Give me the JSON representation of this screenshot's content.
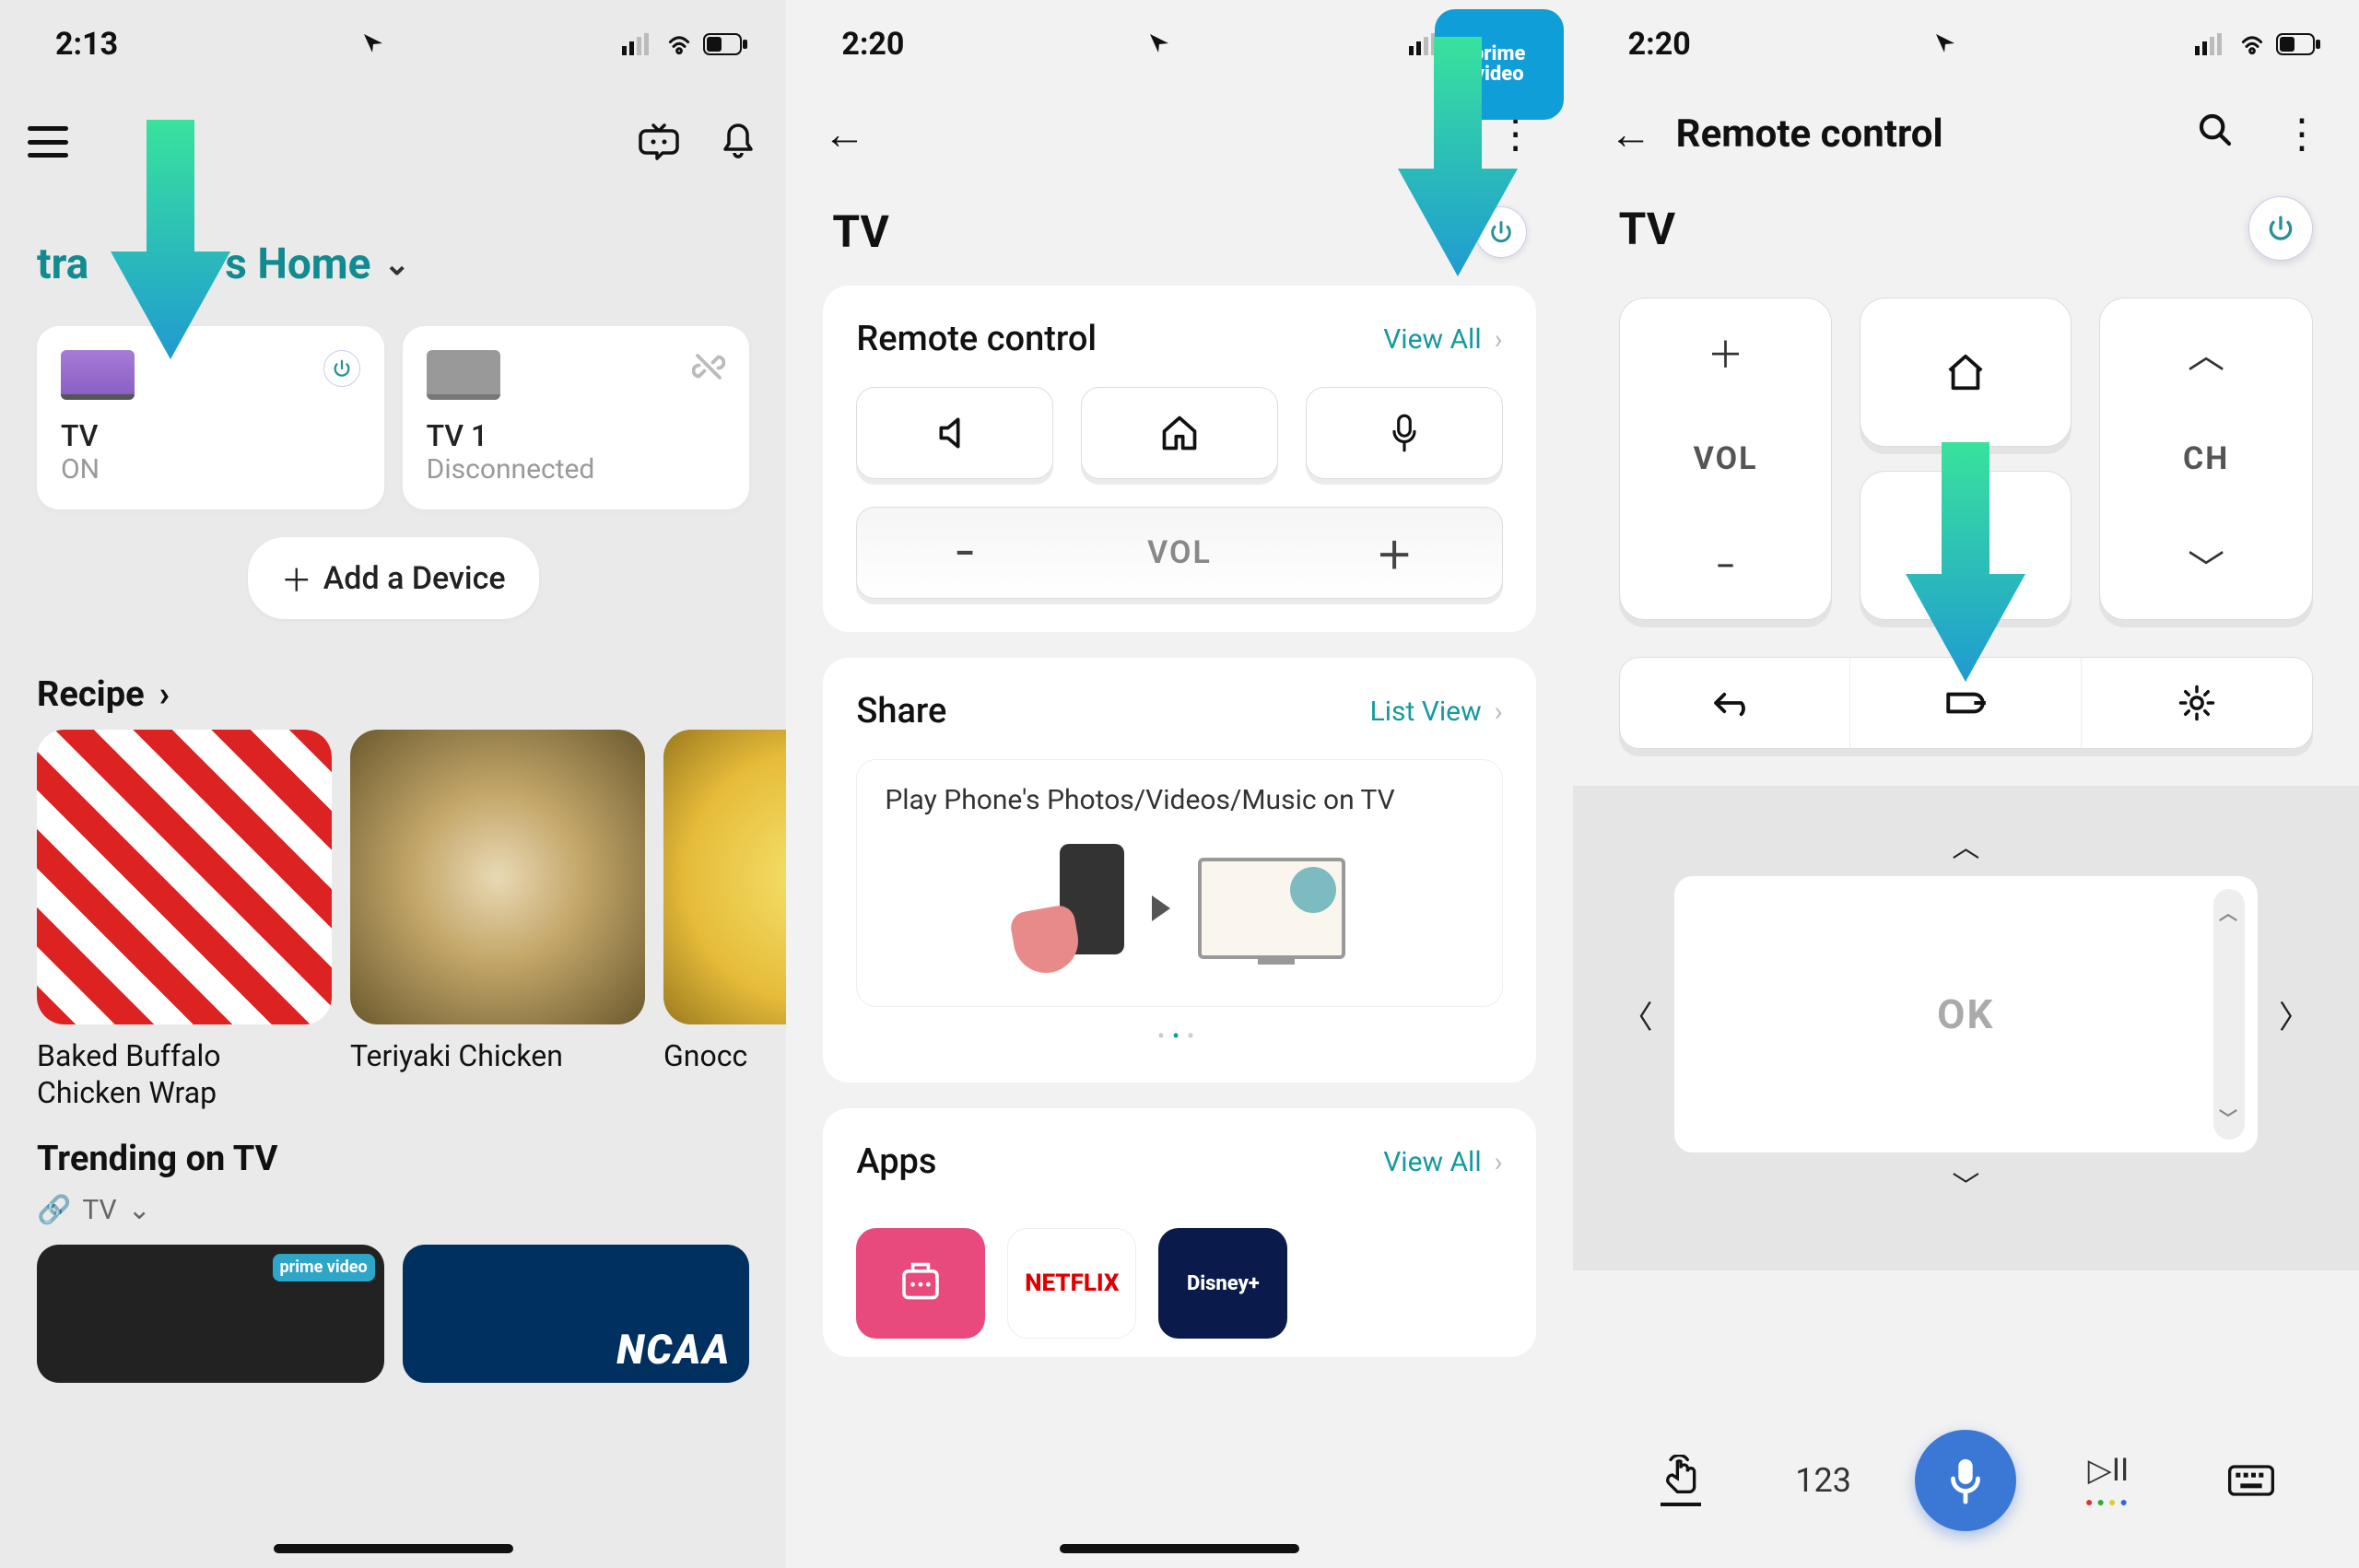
{
  "screen1": {
    "status_time": "2:13",
    "home_title_left": "tra",
    "home_title_right": "s Home",
    "device1": {
      "name": "TV",
      "state": "ON"
    },
    "device2": {
      "name": "TV 1",
      "state": "Disconnected"
    },
    "add_device": "Add a Device",
    "recipe_heading": "Recipe",
    "recipes": [
      {
        "name": "Baked Buffalo Chicken Wrap"
      },
      {
        "name": "Teriyaki Chicken"
      },
      {
        "name": "Gnocc"
      }
    ],
    "trending_heading": "Trending on TV",
    "tv_chip": "TV",
    "prime_badge": "prime video",
    "ncaa": "NCAA"
  },
  "screen2": {
    "status_time": "2:20",
    "title": "TV",
    "remote_heading": "Remote control",
    "view_all": "View All",
    "vol_label": "VOL",
    "share_heading": "Share",
    "list_view": "List View",
    "share_text": "Play Phone's Photos/Videos/Music on TV",
    "apps_heading": "Apps",
    "apps_view_all": "View All",
    "apps": {
      "netflix": "NETFLIX",
      "prime1": "prime",
      "prime2": "video",
      "disney": "Disney+"
    }
  },
  "screen3": {
    "status_time": "2:20",
    "header": "Remote control",
    "title": "TV",
    "vol_label": "VOL",
    "ch_label": "CH",
    "ok_label": "OK",
    "numpad": "123"
  }
}
